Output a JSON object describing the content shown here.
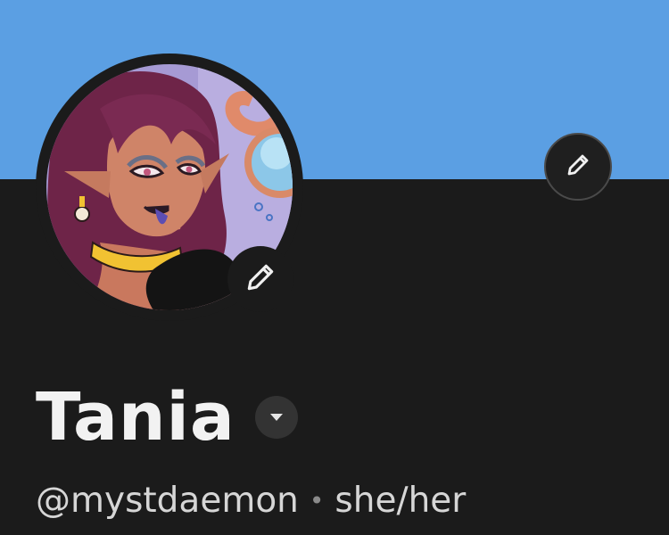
{
  "profile": {
    "display_name": "Tania",
    "handle": "@mystdaemon",
    "separator": "•",
    "pronouns": "she/her"
  },
  "icons": {
    "banner_edit": "pencil-icon",
    "avatar_edit": "pencil-icon",
    "name_dropdown": "chevron-down-icon"
  },
  "colors": {
    "banner": "#5b9fe3",
    "background": "#1b1b1b",
    "text_primary": "#f2f2f2",
    "text_secondary": "#d6d6d6"
  }
}
